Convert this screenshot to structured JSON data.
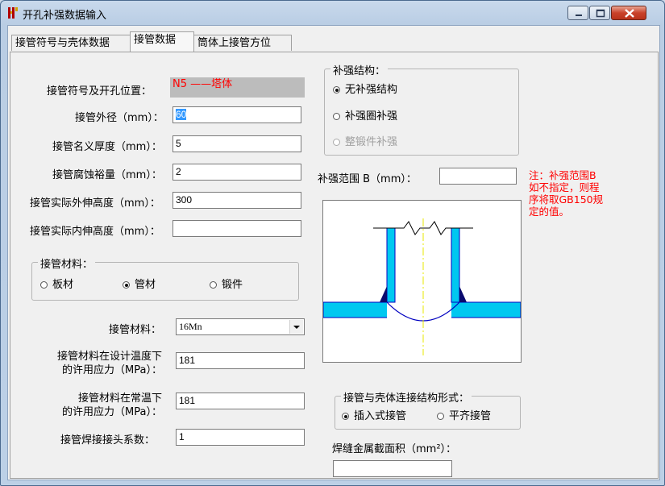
{
  "window": {
    "title": "开孔补强数据输入"
  },
  "tabs": [
    {
      "label": "接管符号与壳体数据"
    },
    {
      "label": "接管数据"
    },
    {
      "label": "筒体上接管方位"
    }
  ],
  "left": {
    "nozzle_symbol_label": "接管符号及开孔位置：",
    "nozzle_symbol_value": "N5 ——塔体",
    "outer_diameter_label": "接管外径（mm）：",
    "outer_diameter_value": "60",
    "thickness_label": "接管名义厚度（mm）：",
    "thickness_value": "5",
    "corrosion_label": "接管腐蚀裕量（mm）：",
    "corrosion_value": "2",
    "ext_height_label": "接管实际外伸高度（mm）：",
    "ext_height_value": "300",
    "int_height_label": "接管实际内伸高度（mm）：",
    "int_height_value": ""
  },
  "material_group": {
    "legend": "接管材料：",
    "options": [
      "板材",
      "管材",
      "锻件"
    ],
    "selected": "管材"
  },
  "material_select": {
    "label": "接管材料：",
    "value": "16Mn"
  },
  "stress_design": {
    "label_line1": "接管材料在设计温度下",
    "label_line2": "的许用应力（MPa）：",
    "value": "181"
  },
  "stress_normal": {
    "label_line1": "接管材料在常温下",
    "label_line2": "的许用应力（MPa）：",
    "value": "181"
  },
  "weld_coef": {
    "label": "接管焊接接头系数：",
    "value": "1"
  },
  "reinforce_group": {
    "legend": "补强结构：",
    "options": [
      "无补强结构",
      "补强圈补强",
      "整锻件补强"
    ],
    "selected": "无补强结构",
    "disabled": "整锻件补强"
  },
  "reinforce_range": {
    "label": "补强范围 B（mm）：",
    "value": ""
  },
  "note": {
    "lines": [
      "注：补强范围B",
      "如不指定，则程",
      "序将取GB150规",
      "定的值。"
    ]
  },
  "connection_group": {
    "legend": "接管与壳体连接结构形式：",
    "options": [
      "插入式接管",
      "平齐接管"
    ],
    "selected": "插入式接管"
  },
  "weld_area": {
    "label": "焊缝金属截面积（mm²）：",
    "value": ""
  },
  "colors": {
    "shell_fill": "#00c8f0",
    "weld_fill": "#0a0a6e",
    "axis": "#e8e800",
    "note_red": "#ff0000"
  }
}
